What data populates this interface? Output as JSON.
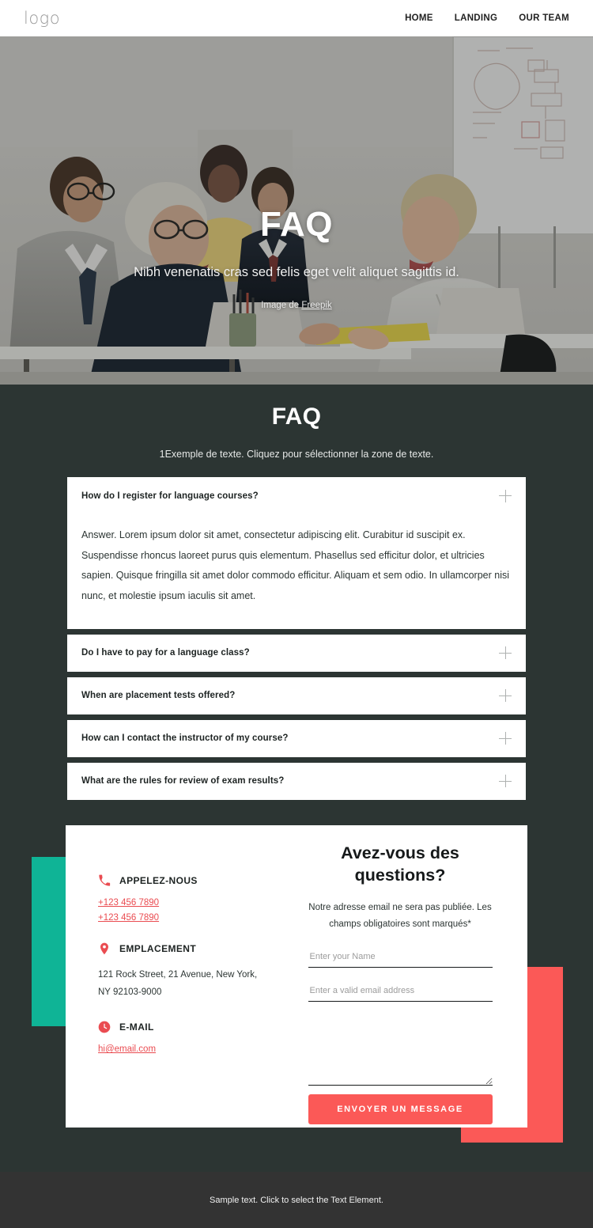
{
  "header": {
    "logo": "logo",
    "nav": [
      {
        "label": "HOME"
      },
      {
        "label": "LANDING"
      },
      {
        "label": "OUR TEAM"
      }
    ]
  },
  "hero": {
    "title": "FAQ",
    "subtitle": "Nibh venenatis cras sed felis eget velit aliquet sagittis id.",
    "credit_prefix": "Image de ",
    "credit_link": "Freepik"
  },
  "faq": {
    "heading": "FAQ",
    "subheading": "1Exemple de texte. Cliquez pour sélectionner la zone de texte.",
    "items": [
      {
        "question": "How do I register for language courses?",
        "answer": "Answer. Lorem ipsum dolor sit amet, consectetur adipiscing elit. Curabitur id suscipit ex. Suspendisse rhoncus laoreet purus quis elementum. Phasellus sed efficitur dolor, et ultricies sapien. Quisque fringilla sit amet dolor commodo efficitur. Aliquam et sem odio. In ullamcorper nisi nunc, et molestie ipsum iaculis sit amet.",
        "expanded": true,
        "toggle_icon": "plus-icon"
      },
      {
        "question": "Do I have to pay for a language class?",
        "expanded": false,
        "toggle_icon": "plus-icon"
      },
      {
        "question": "When are placement tests offered?",
        "expanded": false,
        "toggle_icon": "plus-icon"
      },
      {
        "question": "How can I contact the instructor of my course?",
        "expanded": false,
        "toggle_icon": "plus-icon"
      },
      {
        "question": "What are the rules for review of exam results?",
        "expanded": false,
        "toggle_icon": "plus-icon"
      }
    ]
  },
  "contact": {
    "phone": {
      "icon": "phone-icon",
      "title": "APPELEZ-NOUS",
      "number_1": "+123 456 7890",
      "number_2": "+123 456 7890"
    },
    "location": {
      "icon": "map-pin-icon",
      "title": "EMPLACEMENT",
      "address": "121 Rock Street, 21 Avenue, New York, NY 92103-9000"
    },
    "email": {
      "icon": "clock-circle-icon",
      "title": "E-MAIL",
      "address": "hi@email.com"
    },
    "form": {
      "title": "Avez-vous des questions?",
      "note": "Notre adresse email ne sera pas publiée. Les champs obligatoires sont marqués*",
      "name_placeholder": "Enter your Name",
      "name_value": "",
      "email_placeholder": "Enter a valid email address",
      "email_value": "",
      "message_placeholder": "",
      "message_value": "",
      "submit_label": "ENVOYER UN MESSAGE"
    }
  },
  "footer": {
    "text": "Sample text. Click to select the Text Element."
  },
  "colors": {
    "dark_bg": "#2c3533",
    "footer_bg": "#333333",
    "accent_red": "#fb5957",
    "link_red": "#ea4c51",
    "accent_teal": "#0fb496",
    "card_white": "#ffffff"
  }
}
